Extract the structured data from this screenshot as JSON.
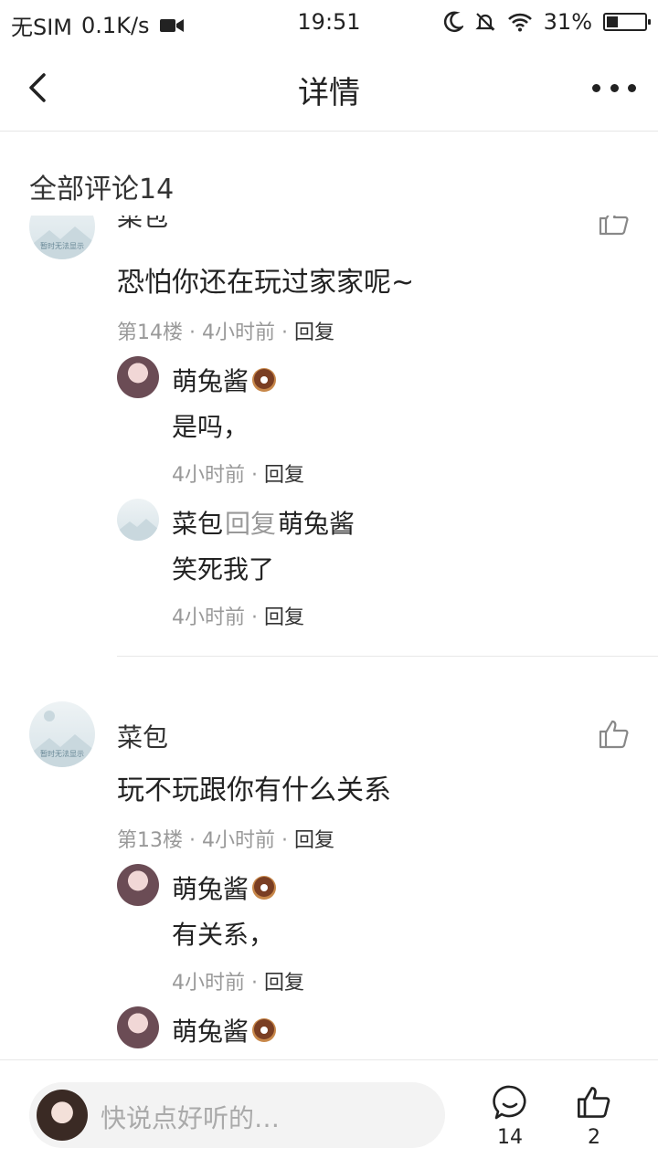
{
  "status_bar": {
    "carrier": "无SIM",
    "speed": "0.1K/s",
    "time": "19:51",
    "battery": "31%",
    "battery_level": 0.31
  },
  "nav": {
    "title": "详情"
  },
  "section": {
    "title": "全部评论14"
  },
  "comments": [
    {
      "author": "菜包",
      "text": "恐怕你还在玩过家家呢~",
      "floor": "第14楼",
      "time": "4小时前",
      "reply_label": "回复",
      "avatar_text": "暂时无法显示",
      "replies": [
        {
          "author": "萌兔酱",
          "text": "是吗，",
          "time": "4小时前",
          "reply_label": "回复"
        },
        {
          "author": "菜包",
          "reply_word": "回复",
          "target": "萌兔酱",
          "text": "笑死我了",
          "time": "4小时前",
          "reply_label": "回复"
        }
      ]
    },
    {
      "author": "菜包",
      "text": "玩不玩跟你有什么关系",
      "floor": "第13楼",
      "time": "4小时前",
      "reply_label": "回复",
      "avatar_text": "暂时无法显示",
      "replies": [
        {
          "author": "萌兔酱",
          "text": "有关系，",
          "time": "4小时前",
          "reply_label": "回复"
        },
        {
          "author": "萌兔酱"
        }
      ]
    }
  ],
  "bottom_bar": {
    "placeholder": "快说点好听的…",
    "comment_count": "14",
    "like_count": "2"
  },
  "icons": {
    "back": "back-arrow-icon",
    "more": "more-dots-icon",
    "like": "thumbs-up-icon",
    "comment": "comment-bubble-icon",
    "donut": "donut-emoji-icon"
  },
  "colors": {
    "text": "#222222",
    "meta": "#999999",
    "divider": "#e8e8e8",
    "input_bg": "#f3f3f3"
  }
}
